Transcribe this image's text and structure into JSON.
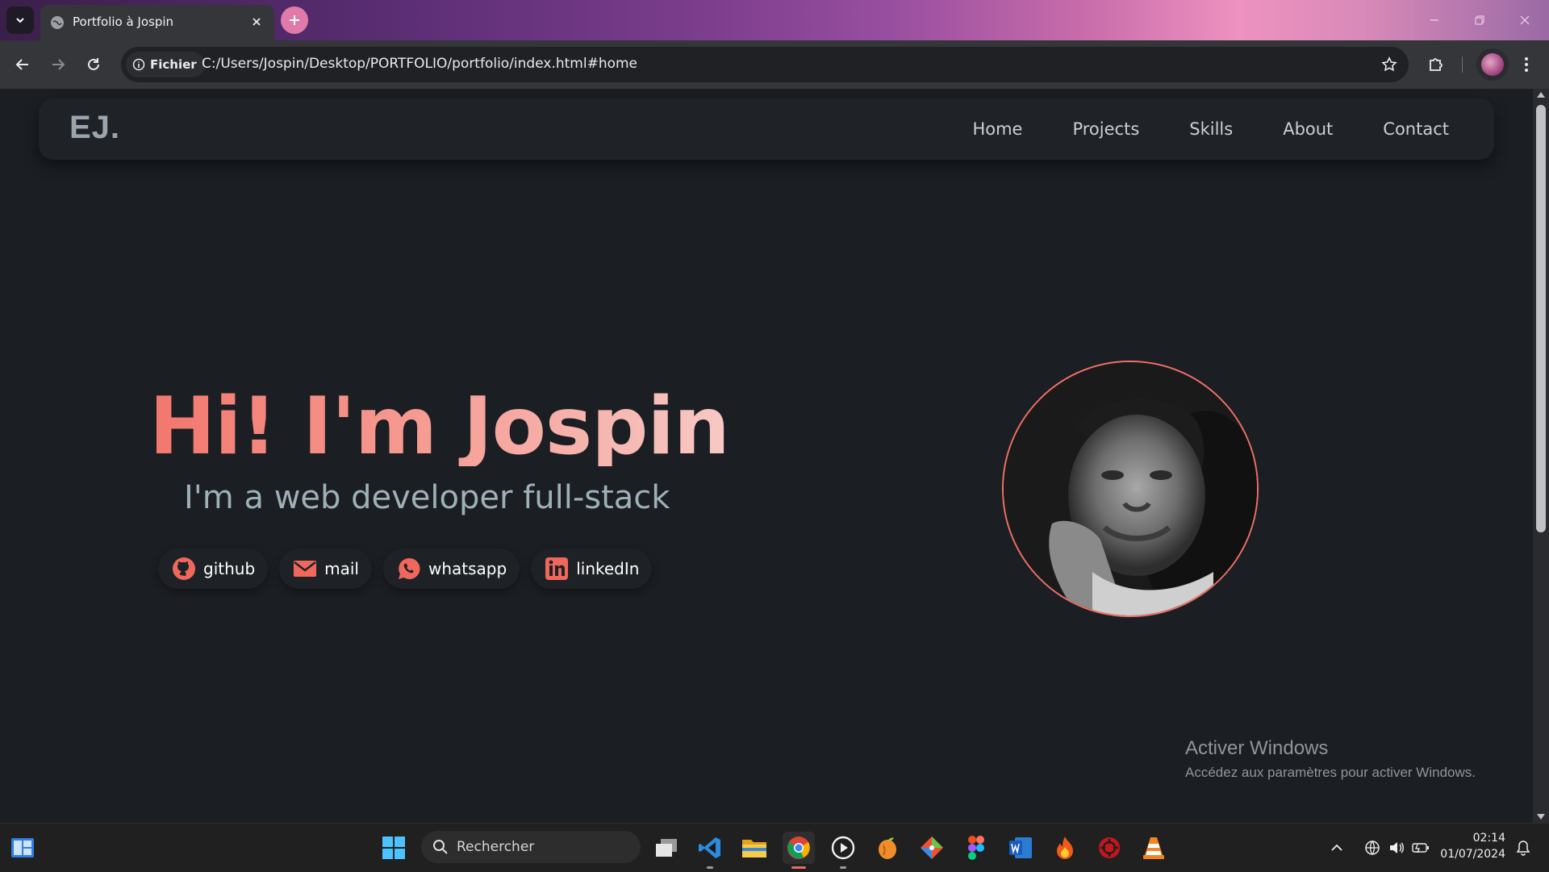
{
  "browser": {
    "tab_title": "Portfolio à Jospin",
    "chip_label": "Fichier",
    "url": "C:/Users/Jospin/Desktop/PORTFOLIO/portfolio/index.html#home"
  },
  "site": {
    "logo": "EJ.",
    "nav": [
      "Home",
      "Projects",
      "Skills",
      "About",
      "Contact"
    ],
    "hero_title": "Hi! I'm Jospin",
    "hero_subtitle": "I'm a web developer full-stack",
    "socials": [
      {
        "label": "github",
        "icon": "github-icon"
      },
      {
        "label": "mail",
        "icon": "mail-icon"
      },
      {
        "label": "whatsapp",
        "icon": "whatsapp-icon"
      },
      {
        "label": "linkedIn",
        "icon": "linkedin-icon"
      }
    ],
    "accent_color": "#f2776d"
  },
  "watermark": {
    "title": "Activer Windows",
    "subtitle": "Accédez aux paramètres pour activer Windows."
  },
  "taskbar": {
    "search_placeholder": "Rechercher",
    "time": "02:14",
    "date": "01/07/2024"
  }
}
